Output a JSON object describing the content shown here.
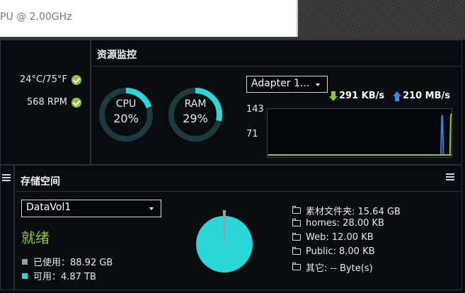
{
  "window": {
    "cpu_model_text": "PU @ 2.00GHz"
  },
  "system_status": {
    "temperature": "24°C/75°F",
    "fan_speed": "568 RPM"
  },
  "resource_monitor": {
    "title": "资源监控",
    "cpu": {
      "label": "CPU",
      "value_text": "20%",
      "percent": 20
    },
    "ram": {
      "label": "RAM",
      "value_text": "29%",
      "percent": 29
    },
    "adapter_select": {
      "value": "Adapter 1..."
    },
    "download_speed": "291 KB/s",
    "upload_speed": "210 MB/s",
    "chart_data": {
      "type": "line",
      "y_ticks": [
        "143",
        "71"
      ],
      "series": [
        {
          "color": "#2f7fe0",
          "values": [
            0,
            0,
            0,
            0,
            0,
            0,
            0,
            0,
            0,
            0,
            0,
            0,
            0,
            0,
            0,
            0,
            0,
            0,
            0,
            0,
            0,
            0,
            0,
            0,
            0,
            0,
            0,
            0,
            0,
            0,
            0,
            0,
            0,
            0,
            0,
            0,
            0,
            0,
            0,
            0,
            0,
            0,
            0,
            0,
            0,
            0,
            0,
            0,
            0,
            0,
            0,
            0,
            0,
            0,
            0,
            0,
            0,
            0,
            0,
            0,
            0,
            0,
            0,
            0,
            0,
            0,
            0,
            0,
            0,
            0,
            0,
            0,
            0,
            0,
            0,
            0,
            0,
            0,
            0,
            0,
            0,
            0,
            0,
            0,
            0,
            0,
            0,
            0,
            0,
            0,
            0,
            0,
            0,
            0,
            0,
            0,
            0,
            0,
            0,
            0,
            0,
            0,
            0,
            0,
            0,
            0,
            0,
            0,
            0,
            0,
            0,
            0,
            0,
            0,
            0,
            0,
            0,
            0,
            0,
            0,
            0,
            0,
            0,
            0,
            0,
            0,
            0,
            0,
            0,
            0,
            0,
            0,
            0,
            0,
            0,
            0,
            0,
            0,
            0,
            0,
            0,
            0,
            0,
            0,
            0,
            0,
            0,
            0,
            0,
            0,
            0,
            0,
            0,
            0,
            0,
            0,
            0,
            0,
            0,
            0,
            0,
            0,
            0,
            0,
            0,
            0,
            0,
            0,
            0,
            0,
            0,
            0,
            0,
            0,
            0,
            0,
            0,
            0,
            0,
            0,
            0,
            0,
            0,
            0,
            0,
            0,
            0,
            0,
            0,
            0,
            0,
            0,
            0,
            0,
            0,
            0,
            0,
            0,
            0,
            0,
            0,
            0,
            0,
            0,
            0,
            0,
            0,
            0,
            0,
            0,
            0,
            0,
            120,
            130,
            0,
            0,
            0,
            0,
            0,
            0,
            0,
            0,
            0,
            0,
            0
          ]
        },
        {
          "color": "#8cc63f",
          "values": [
            0,
            0,
            0,
            0,
            0,
            0,
            0,
            0,
            0,
            0,
            0,
            0,
            0,
            0,
            0,
            0,
            0,
            0,
            0,
            0,
            0,
            0,
            0,
            0,
            0,
            0,
            0,
            0,
            0,
            0,
            0,
            0,
            0,
            0,
            0,
            0,
            0,
            0,
            0,
            0,
            0,
            0,
            0,
            0,
            0,
            0,
            0,
            0,
            0,
            0,
            0,
            0,
            0,
            0,
            0,
            0,
            0,
            0,
            0,
            0,
            0,
            0,
            0,
            0,
            0,
            0,
            0,
            0,
            0,
            0,
            0,
            0,
            0,
            0,
            0,
            0,
            0,
            0,
            0,
            0,
            0,
            0,
            0,
            0,
            0,
            0,
            0,
            0,
            0,
            0,
            0,
            0,
            0,
            0,
            0,
            0,
            0,
            0,
            0,
            0,
            0,
            0,
            0,
            0,
            0,
            0,
            0,
            0,
            0,
            0,
            0,
            0,
            0,
            0,
            0,
            0,
            0,
            0,
            0,
            0,
            0,
            0,
            0,
            0,
            0,
            0,
            0,
            0,
            0,
            0,
            0,
            0,
            0,
            0,
            0,
            0,
            0,
            0,
            0,
            0,
            0,
            0,
            0,
            0,
            0,
            0,
            0,
            0,
            0,
            0,
            0,
            0,
            0,
            0,
            0,
            0,
            0,
            0,
            0,
            0,
            0,
            0,
            0,
            0,
            0,
            0,
            0,
            0,
            0,
            0,
            0,
            0,
            0,
            0,
            0,
            0,
            0,
            0,
            0,
            0,
            0,
            0,
            0,
            0,
            0,
            0,
            0,
            0,
            0,
            0,
            0,
            0,
            0,
            0,
            0,
            0,
            0,
            0,
            0,
            0,
            0,
            0,
            0,
            0,
            0,
            0,
            0,
            0,
            0,
            0,
            0,
            0,
            0,
            0,
            0,
            0,
            0,
            0,
            0,
            0,
            0,
            0,
            0,
            0,
            0,
            125,
            135
          ]
        }
      ],
      "y_max": 143
    }
  },
  "storage": {
    "title": "存储空间",
    "volume_select": {
      "value": "DataVol1"
    },
    "status": "就绪",
    "used_label": "已使用：88.92 GB",
    "free_label": "可用：4.87 TB",
    "used_color": "#9c9c9c",
    "free_color": "#2ad6d8",
    "used_fraction": 0.0179,
    "folders": [
      "素材文件夹: 15.64 GB",
      "homes: 28.00 KB",
      "Web: 12.00 KB",
      "Public: 8.00 KB",
      "其它: -- Byte(s)"
    ]
  },
  "colors": {
    "gauge_fill": "#2ad6d8",
    "gauge_track": "#1d3a3f",
    "download_arrow": "#8cc63f",
    "upload_arrow": "#2f8fe8"
  }
}
